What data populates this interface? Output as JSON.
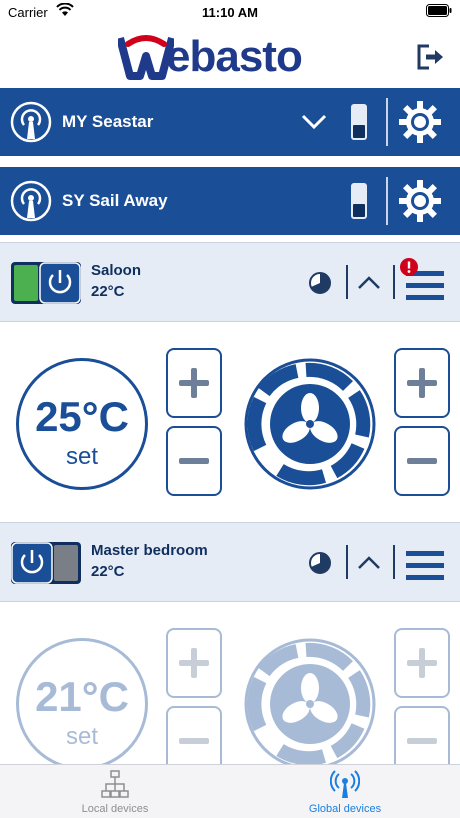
{
  "status_bar": {
    "carrier": "Carrier",
    "time": "11:10 AM"
  },
  "header": {
    "logo_text": "ebasto",
    "logo_icon": "webasto-w-logo",
    "logout_icon": "logout-icon"
  },
  "devices": [
    {
      "name": "MY Seastar",
      "expanded": true
    },
    {
      "name": "SY Sail Away",
      "expanded": false
    }
  ],
  "zones": [
    {
      "name": "Saloon",
      "temp": "22°C",
      "set_value": "25°C",
      "set_unit": "set",
      "power_on": true,
      "alert": true,
      "enabled": true
    },
    {
      "name": "Master bedroom",
      "temp": "22°C",
      "set_value": "21°C",
      "set_unit": "set",
      "power_on": false,
      "alert": false,
      "enabled": false
    }
  ],
  "tabs": [
    {
      "label": "Local devices",
      "icon": "network-icon",
      "active": false
    },
    {
      "label": "Global devices",
      "icon": "antenna-icon",
      "active": true
    }
  ],
  "colors": {
    "primary": "#1a4e97",
    "header_text": "#ffffff",
    "zone_bg": "#e6ecf6",
    "power_on": "#4caf50",
    "alert": "#d0021b",
    "tab_active": "#1c7fe0"
  }
}
